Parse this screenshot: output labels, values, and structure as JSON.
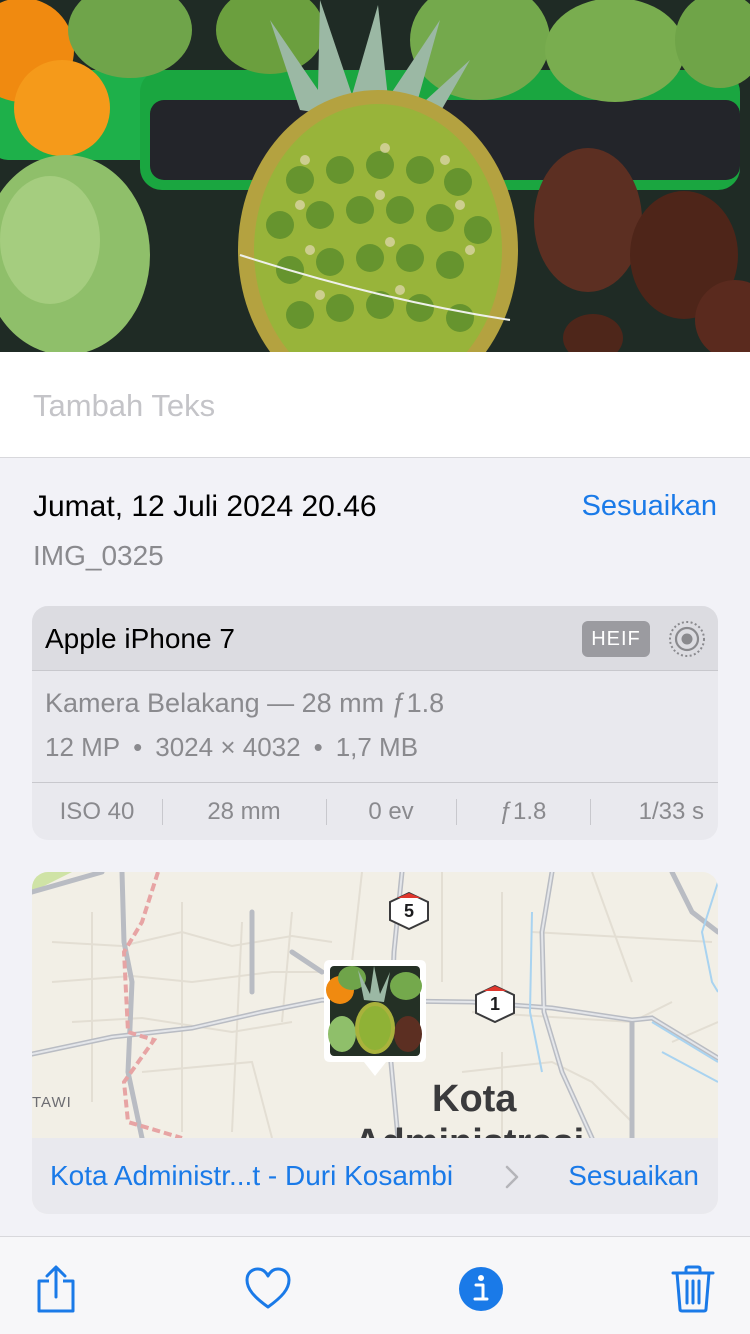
{
  "caption": {
    "placeholder": "Tambah Teks"
  },
  "meta": {
    "date": "Jumat, 12 Juli 2024 20.46",
    "adjust_label": "Sesuaikan",
    "filename": "IMG_0325"
  },
  "exif": {
    "device": "Apple iPhone 7",
    "format": "HEIF",
    "live_icon": "live-photo-icon",
    "lens": "Kamera Belakang — 28 mm ƒ1.8",
    "specs": [
      "12 MP",
      "3024 × 4032",
      "1,7 MB"
    ],
    "values": [
      "ISO 40",
      "28 mm",
      "0 ev",
      "ƒ1.8",
      "1/33 s"
    ]
  },
  "map": {
    "label_line1": "Kota",
    "label_line2": "Administrasi",
    "label_small": "TAWI",
    "shields": [
      "5",
      "1"
    ],
    "location": "Kota Administr...t - Duri Kosambi",
    "adjust_label": "Sesuaikan"
  },
  "toolbar": {
    "icons": [
      "share-icon",
      "heart-icon",
      "info-icon",
      "trash-icon"
    ]
  },
  "colors": {
    "accent": "#1a7ae8",
    "secondary_text": "#8a8a8e",
    "card_bg": "#e9e9ee"
  }
}
